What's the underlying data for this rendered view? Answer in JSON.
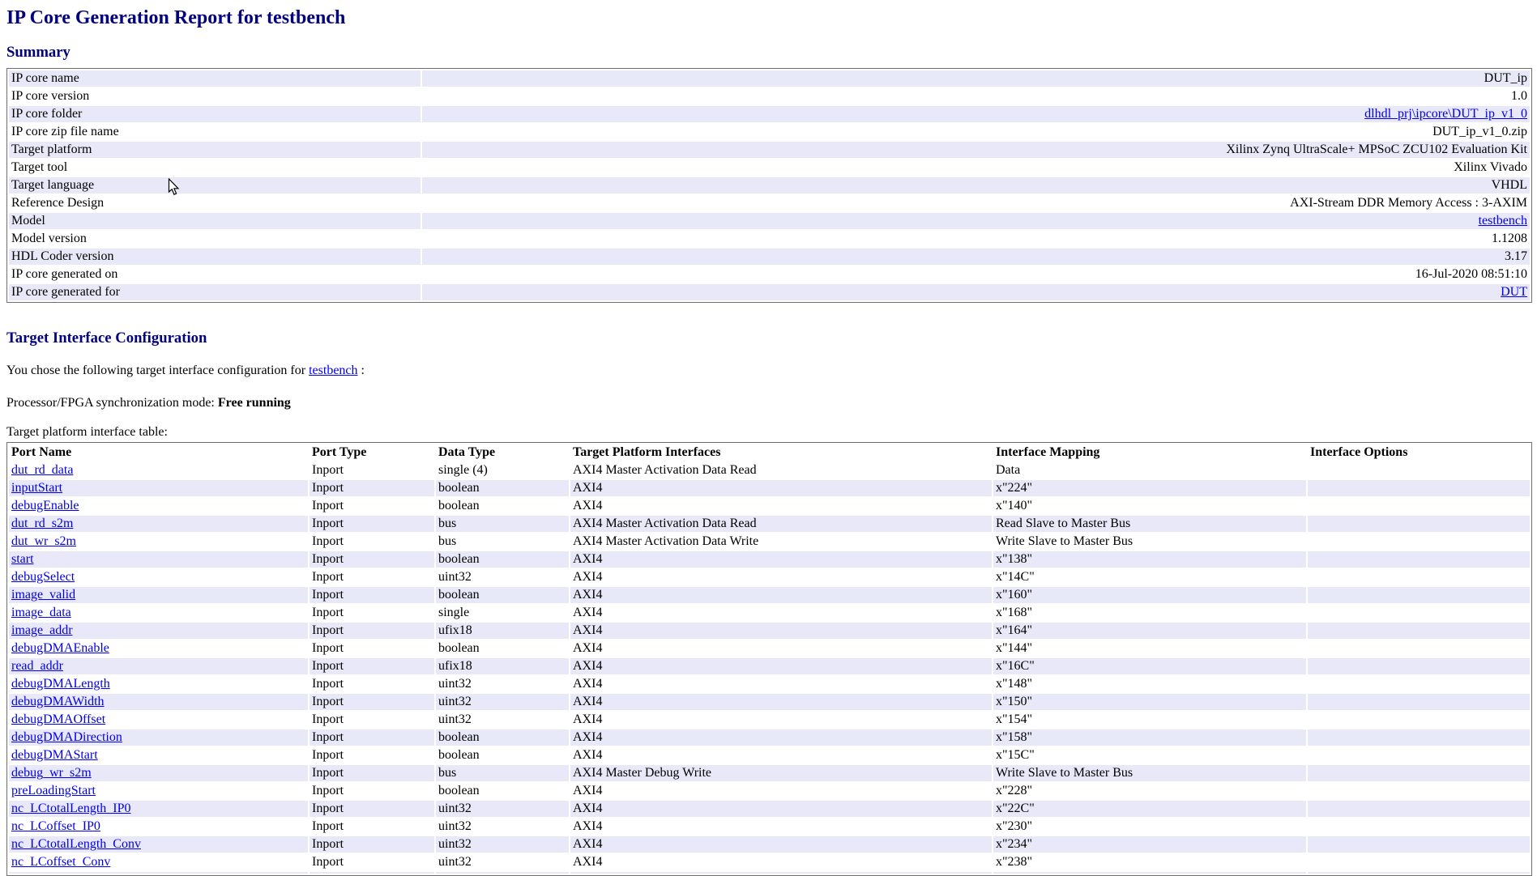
{
  "page": {
    "title": "IP Core Generation Report for testbench"
  },
  "sections": {
    "summary_heading": "Summary",
    "tic_heading": "Target Interface Configuration",
    "tic_intro_prefix": "You chose the following target interface configuration for ",
    "tic_intro_link": "testbench",
    "tic_intro_suffix": " :",
    "sync_mode_label": "Processor/FPGA synchronization mode: ",
    "sync_mode_value": "Free running",
    "ports_table_caption": "Target platform interface table:"
  },
  "summary_table": {
    "rows": [
      {
        "label": "IP core name",
        "value": "DUT_ip",
        "link": false
      },
      {
        "label": "IP core version",
        "value": "1.0",
        "link": false
      },
      {
        "label": "IP core folder",
        "value": "dlhdl_prj\\ipcore\\DUT_ip_v1_0",
        "link": true
      },
      {
        "label": "IP core zip file name",
        "value": "DUT_ip_v1_0.zip",
        "link": false
      },
      {
        "label": "Target platform",
        "value": "Xilinx Zynq UltraScale+ MPSoC ZCU102 Evaluation Kit",
        "link": false
      },
      {
        "label": "Target tool",
        "value": "Xilinx Vivado",
        "link": false
      },
      {
        "label": "Target language",
        "value": "VHDL",
        "link": false
      },
      {
        "label": "Reference Design",
        "value": "AXI-Stream DDR Memory Access : 3-AXIM",
        "link": false
      },
      {
        "label": "Model",
        "value": "testbench",
        "link": true
      },
      {
        "label": "Model version",
        "value": "1.1208",
        "link": false
      },
      {
        "label": "HDL Coder version",
        "value": "3.17",
        "link": false
      },
      {
        "label": "IP core generated on",
        "value": "16-Jul-2020 08:51:10",
        "link": false
      },
      {
        "label": "IP core generated for",
        "value": "DUT",
        "link": true
      }
    ]
  },
  "ports_table": {
    "headers": [
      "Port Name",
      "Port Type",
      "Data Type",
      "Target Platform Interfaces",
      "Interface Mapping",
      "Interface Options"
    ],
    "rows": [
      [
        "dut_rd_data",
        "Inport",
        "single (4)",
        "AXI4 Master Activation Data Read",
        "Data",
        ""
      ],
      [
        "inputStart",
        "Inport",
        "boolean",
        "AXI4",
        "x\"224\"",
        ""
      ],
      [
        "debugEnable",
        "Inport",
        "boolean",
        "AXI4",
        "x\"140\"",
        ""
      ],
      [
        "dut_rd_s2m",
        "Inport",
        "bus",
        "AXI4 Master Activation Data Read",
        "Read Slave to Master Bus",
        ""
      ],
      [
        "dut_wr_s2m",
        "Inport",
        "bus",
        "AXI4 Master Activation Data Write",
        "Write Slave to Master Bus",
        ""
      ],
      [
        "start",
        "Inport",
        "boolean",
        "AXI4",
        "x\"138\"",
        ""
      ],
      [
        "debugSelect",
        "Inport",
        "uint32",
        "AXI4",
        "x\"14C\"",
        ""
      ],
      [
        "image_valid",
        "Inport",
        "boolean",
        "AXI4",
        "x\"160\"",
        ""
      ],
      [
        "image_data",
        "Inport",
        "single",
        "AXI4",
        "x\"168\"",
        ""
      ],
      [
        "image_addr",
        "Inport",
        "ufix18",
        "AXI4",
        "x\"164\"",
        ""
      ],
      [
        "debugDMAEnable",
        "Inport",
        "boolean",
        "AXI4",
        "x\"144\"",
        ""
      ],
      [
        "read_addr",
        "Inport",
        "ufix18",
        "AXI4",
        "x\"16C\"",
        ""
      ],
      [
        "debugDMALength",
        "Inport",
        "uint32",
        "AXI4",
        "x\"148\"",
        ""
      ],
      [
        "debugDMAWidth",
        "Inport",
        "uint32",
        "AXI4",
        "x\"150\"",
        ""
      ],
      [
        "debugDMAOffset",
        "Inport",
        "uint32",
        "AXI4",
        "x\"154\"",
        ""
      ],
      [
        "debugDMADirection",
        "Inport",
        "boolean",
        "AXI4",
        "x\"158\"",
        ""
      ],
      [
        "debugDMAStart",
        "Inport",
        "boolean",
        "AXI4",
        "x\"15C\"",
        ""
      ],
      [
        "debug_wr_s2m",
        "Inport",
        "bus",
        "AXI4 Master Debug Write",
        "Write Slave to Master Bus",
        ""
      ],
      [
        "preLoadingStart",
        "Inport",
        "boolean",
        "AXI4",
        "x\"228\"",
        ""
      ],
      [
        "nc_LCtotalLength_IP0",
        "Inport",
        "uint32",
        "AXI4",
        "x\"22C\"",
        ""
      ],
      [
        "nc_LCoffset_IP0",
        "Inport",
        "uint32",
        "AXI4",
        "x\"230\"",
        ""
      ],
      [
        "nc_LCtotalLength_Conv",
        "Inport",
        "uint32",
        "AXI4",
        "x\"234\"",
        ""
      ],
      [
        "nc_LCoffset_Conv",
        "Inport",
        "uint32",
        "AXI4",
        "x\"238\"",
        ""
      ]
    ],
    "partial_row": true
  },
  "colors": {
    "heading": "#000080",
    "link": "#0000EE",
    "row_stripe": "#E8E8F8",
    "table_border": "#6e6e6e",
    "text": "#000000"
  }
}
